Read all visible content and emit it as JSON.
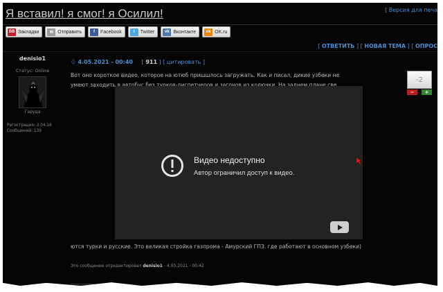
{
  "site": {
    "title": "Я вставил! я смог! я Осилил!",
    "print_link": "[ Версия для печа"
  },
  "share": [
    {
      "label": "Закладки",
      "icon": "bookmarks-icon",
      "color": "#c0202a",
      "glyph": "BB"
    },
    {
      "label": "Отправить",
      "icon": "mail-icon",
      "color": "#9a9a9a",
      "glyph": "✉"
    },
    {
      "label": "Facebook",
      "icon": "facebook-icon",
      "color": "#3b5998",
      "glyph": "f"
    },
    {
      "label": "Twitter",
      "icon": "twitter-icon",
      "color": "#4aa8e0",
      "glyph": "t"
    },
    {
      "label": "Вконтакте",
      "icon": "vk-icon",
      "color": "#4a76a8",
      "glyph": "vk"
    },
    {
      "label": "OK.ru",
      "icon": "ok-icon",
      "color": "#ee8208",
      "glyph": "ok"
    }
  ],
  "actions": {
    "reply": "ОТВЕТИТЬ",
    "new_topic": "НОВАЯ ТЕМА",
    "poll": "ОПРОС"
  },
  "author": {
    "name": "denisio1",
    "status": "Статус: Online",
    "avatar_caption": "Гаруда",
    "registered": "Регистрация: 3.04.16",
    "messages": "Сообщений: 139"
  },
  "post": {
    "date": "4.05.2021 - 00:40",
    "number": "911",
    "quote": "цитировать",
    "text": "Вот оно короткое видео, которое на ютюб пришшлось загружать. Как и писал, дикие узбеки не умеют заходить в автобус без турков-диспетчеров и загонов из колючки. На заднем плане све",
    "text_after": "ются турки и русские. Это великая стройка газпрома - Амурский ГПЗ. где работают в основном узбеки)",
    "edited_prefix": "Это сообщение отредактировал",
    "edited_user": "denisio1",
    "edited_suffix": "- 4.05.2021 - 00:42",
    "separator": "-------------------"
  },
  "rating": {
    "value": "-2",
    "minus": "−",
    "plus": "+"
  },
  "video": {
    "title": "Видео недоступно",
    "subtitle": "Автор ограничил доступ к видео."
  }
}
